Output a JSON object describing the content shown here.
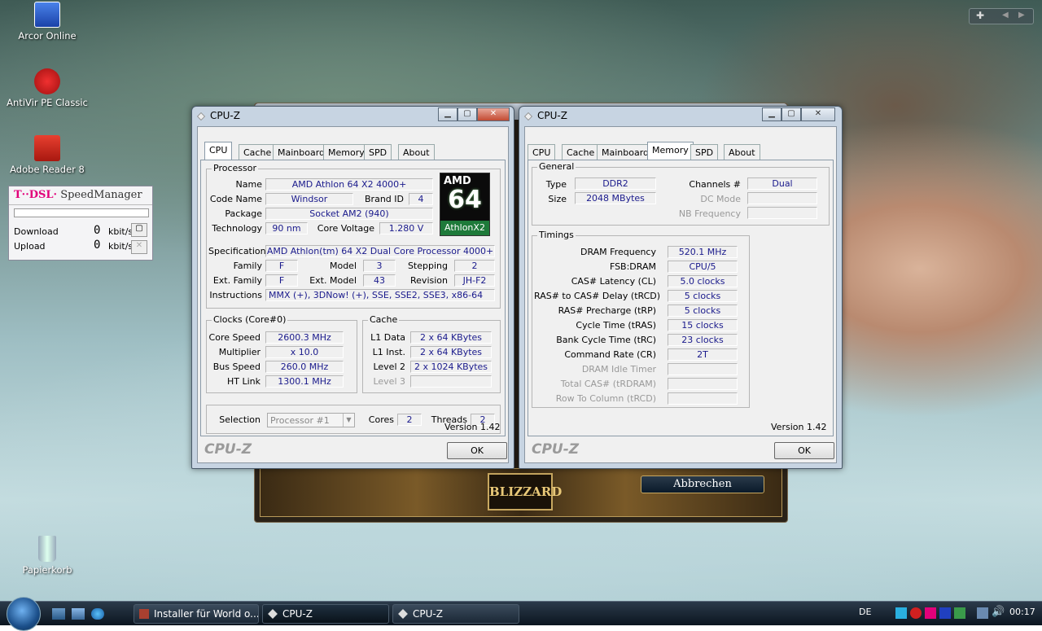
{
  "desktop": {
    "icons": [
      {
        "label": "Arcor Online",
        "color": "#2a62c9"
      },
      {
        "label": "AntiVir PE Classic",
        "color": "#d82020"
      },
      {
        "label": "Adobe Reader 8",
        "color": "#c8281e"
      },
      {
        "label": "Papierkorb",
        "color": "#a8c4d4"
      }
    ]
  },
  "speedmanager": {
    "title_brand": "T··DSL·",
    "title_app": "SpeedManager",
    "download_label": "Download",
    "download_value": "0",
    "upload_label": "Upload",
    "upload_value": "0",
    "unit": "kbit/s"
  },
  "installer": {
    "cancel_label": "Abbrechen",
    "logo": "BLIZZARD"
  },
  "cpuz_left": {
    "title": "CPU-Z",
    "tabs": [
      "CPU",
      "Cache",
      "Mainboard",
      "Memory",
      "SPD",
      "About"
    ],
    "active_tab": "CPU",
    "processor": {
      "group": "Processor",
      "name_label": "Name",
      "name": "AMD Athlon 64 X2 4000+",
      "codename_label": "Code Name",
      "codename": "Windsor",
      "brandid_label": "Brand ID",
      "brandid": "4",
      "package_label": "Package",
      "package": "Socket AM2 (940)",
      "technology_label": "Technology",
      "technology": "90 nm",
      "corevoltage_label": "Core Voltage",
      "corevoltage": "1.280 V",
      "spec_label": "Specification",
      "spec": "AMD Athlon(tm) 64 X2 Dual Core Processor 4000+",
      "family_label": "Family",
      "family": "F",
      "model_label": "Model",
      "model": "3",
      "stepping_label": "Stepping",
      "stepping": "2",
      "extfamily_label": "Ext. Family",
      "extfamily": "F",
      "extmodel_label": "Ext. Model",
      "extmodel": "43",
      "revision_label": "Revision",
      "revision": "JH-F2",
      "instructions_label": "Instructions",
      "instructions": "MMX (+), 3DNow! (+), SSE, SSE2, SSE3, x86-64",
      "logo_amd": "AMD",
      "logo_64": "64",
      "logo_athlon": "Athlon",
      "logo_x2": "X2"
    },
    "clocks": {
      "group": "Clocks (Core#0)",
      "corespeed_label": "Core Speed",
      "corespeed": "2600.3 MHz",
      "multiplier_label": "Multiplier",
      "multiplier": "x 10.0",
      "busspeed_label": "Bus Speed",
      "busspeed": "260.0 MHz",
      "htlink_label": "HT Link",
      "htlink": "1300.1 MHz"
    },
    "cache": {
      "group": "Cache",
      "l1data_label": "L1 Data",
      "l1data": "2 x 64 KBytes",
      "l1inst_label": "L1 Inst.",
      "l1inst": "2 x 64 KBytes",
      "level2_label": "Level 2",
      "level2": "2 x 1024 KBytes",
      "level3_label": "Level 3",
      "level3": ""
    },
    "selection": {
      "label": "Selection",
      "value": "Processor #1",
      "cores_label": "Cores",
      "cores": "2",
      "threads_label": "Threads",
      "threads": "2"
    },
    "version": "Version 1.42",
    "brand": "CPU-Z",
    "ok": "OK"
  },
  "cpuz_right": {
    "title": "CPU-Z",
    "tabs": [
      "CPU",
      "Cache",
      "Mainboard",
      "Memory",
      "SPD",
      "About"
    ],
    "active_tab": "Memory",
    "general": {
      "group": "General",
      "type_label": "Type",
      "type": "DDR2",
      "size_label": "Size",
      "size": "2048 MBytes",
      "channels_label": "Channels #",
      "channels": "Dual",
      "dcmode_label": "DC Mode",
      "dcmode": "",
      "nbfreq_label": "NB Frequency",
      "nbfreq": ""
    },
    "timings": {
      "group": "Timings",
      "rows": [
        {
          "label": "DRAM Frequency",
          "value": "520.1 MHz",
          "disabled": false
        },
        {
          "label": "FSB:DRAM",
          "value": "CPU/5",
          "disabled": false
        },
        {
          "label": "CAS# Latency (CL)",
          "value": "5.0 clocks",
          "disabled": false
        },
        {
          "label": "RAS# to CAS# Delay (tRCD)",
          "value": "5 clocks",
          "disabled": false
        },
        {
          "label": "RAS# Precharge (tRP)",
          "value": "5 clocks",
          "disabled": false
        },
        {
          "label": "Cycle Time (tRAS)",
          "value": "15 clocks",
          "disabled": false
        },
        {
          "label": "Bank Cycle Time (tRC)",
          "value": "23 clocks",
          "disabled": false
        },
        {
          "label": "Command Rate (CR)",
          "value": "2T",
          "disabled": false
        },
        {
          "label": "DRAM Idle Timer",
          "value": "",
          "disabled": true
        },
        {
          "label": "Total CAS# (tRDRAM)",
          "value": "",
          "disabled": true
        },
        {
          "label": "Row To Column (tRCD)",
          "value": "",
          "disabled": true
        }
      ]
    },
    "version": "Version 1.42",
    "brand": "CPU-Z",
    "ok": "OK"
  },
  "taskbar": {
    "items": [
      {
        "label": "Installer für World o..."
      },
      {
        "label": "CPU-Z"
      },
      {
        "label": "CPU-Z"
      }
    ],
    "lang": "DE",
    "time": "00:17"
  }
}
